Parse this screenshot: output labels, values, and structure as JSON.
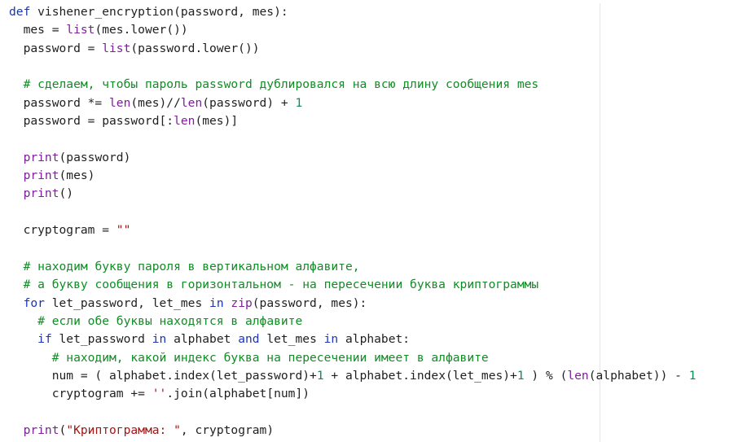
{
  "code": {
    "lines": [
      [
        {
          "t": "def",
          "c": "kw"
        },
        {
          "t": " vishener_encryption(password, mes):",
          "c": ""
        }
      ],
      [
        {
          "t": "  mes = ",
          "c": ""
        },
        {
          "t": "list",
          "c": "bi"
        },
        {
          "t": "(mes.lower())",
          "c": ""
        }
      ],
      [
        {
          "t": "  password = ",
          "c": ""
        },
        {
          "t": "list",
          "c": "bi"
        },
        {
          "t": "(password.lower())",
          "c": ""
        }
      ],
      [],
      [
        {
          "t": "  ",
          "c": ""
        },
        {
          "t": "# сделаем, чтобы пароль password дублировался на всю длину сообщения mes",
          "c": "cm"
        }
      ],
      [
        {
          "t": "  password *= ",
          "c": ""
        },
        {
          "t": "len",
          "c": "bi"
        },
        {
          "t": "(mes)//",
          "c": ""
        },
        {
          "t": "len",
          "c": "bi"
        },
        {
          "t": "(password) + ",
          "c": ""
        },
        {
          "t": "1",
          "c": "num"
        }
      ],
      [
        {
          "t": "  password = password[:",
          "c": ""
        },
        {
          "t": "len",
          "c": "bi"
        },
        {
          "t": "(mes)]",
          "c": ""
        }
      ],
      [],
      [
        {
          "t": "  ",
          "c": ""
        },
        {
          "t": "print",
          "c": "bi"
        },
        {
          "t": "(password)",
          "c": ""
        }
      ],
      [
        {
          "t": "  ",
          "c": ""
        },
        {
          "t": "print",
          "c": "bi"
        },
        {
          "t": "(mes)",
          "c": ""
        }
      ],
      [
        {
          "t": "  ",
          "c": ""
        },
        {
          "t": "print",
          "c": "bi"
        },
        {
          "t": "()",
          "c": ""
        }
      ],
      [],
      [
        {
          "t": "  cryptogram = ",
          "c": ""
        },
        {
          "t": "\"\"",
          "c": "str"
        }
      ],
      [],
      [
        {
          "t": "  ",
          "c": ""
        },
        {
          "t": "# находим букву пароля в вертикальном алфавите,",
          "c": "cm"
        }
      ],
      [
        {
          "t": "  ",
          "c": ""
        },
        {
          "t": "# а букву сообщения в горизонтальном - на пересечении буква криптограммы",
          "c": "cm"
        }
      ],
      [
        {
          "t": "  ",
          "c": ""
        },
        {
          "t": "for",
          "c": "kw"
        },
        {
          "t": " let_password, let_mes ",
          "c": ""
        },
        {
          "t": "in",
          "c": "kw"
        },
        {
          "t": " ",
          "c": ""
        },
        {
          "t": "zip",
          "c": "bi"
        },
        {
          "t": "(password, mes):",
          "c": ""
        }
      ],
      [
        {
          "t": "    ",
          "c": ""
        },
        {
          "t": "# если обе буквы находятся в алфавите",
          "c": "cm"
        }
      ],
      [
        {
          "t": "    ",
          "c": ""
        },
        {
          "t": "if",
          "c": "kw"
        },
        {
          "t": " let_password ",
          "c": ""
        },
        {
          "t": "in",
          "c": "kw"
        },
        {
          "t": " alphabet ",
          "c": ""
        },
        {
          "t": "and",
          "c": "kw"
        },
        {
          "t": " let_mes ",
          "c": ""
        },
        {
          "t": "in",
          "c": "kw"
        },
        {
          "t": " alphabet:",
          "c": ""
        }
      ],
      [
        {
          "t": "      ",
          "c": ""
        },
        {
          "t": "# находим, какой индекс буква на пересечении имеет в алфавите",
          "c": "cm"
        }
      ],
      [
        {
          "t": "      num = ( alphabet.index(let_password)+",
          "c": ""
        },
        {
          "t": "1",
          "c": "num"
        },
        {
          "t": " + alphabet.index(let_mes)+",
          "c": ""
        },
        {
          "t": "1",
          "c": "num"
        },
        {
          "t": " ) % (",
          "c": ""
        },
        {
          "t": "len",
          "c": "bi"
        },
        {
          "t": "(alphabet)) - ",
          "c": ""
        },
        {
          "t": "1",
          "c": "num"
        }
      ],
      [
        {
          "t": "      cryptogram += ",
          "c": ""
        },
        {
          "t": "''",
          "c": "str"
        },
        {
          "t": ".join(alphabet[num])",
          "c": ""
        }
      ],
      [],
      [
        {
          "t": "  ",
          "c": ""
        },
        {
          "t": "print",
          "c": "bi"
        },
        {
          "t": "(",
          "c": ""
        },
        {
          "t": "\"Криптограмма: \"",
          "c": "str"
        },
        {
          "t": ", cryptogram)",
          "c": ""
        }
      ]
    ]
  },
  "colors": {
    "keyword": "#1a34b8",
    "builtin": "#7d1f9a",
    "comment": "#118c25",
    "number": "#0b8a56",
    "string": "#a31515",
    "text": "#1f1f1f",
    "background": "#ffffff"
  }
}
